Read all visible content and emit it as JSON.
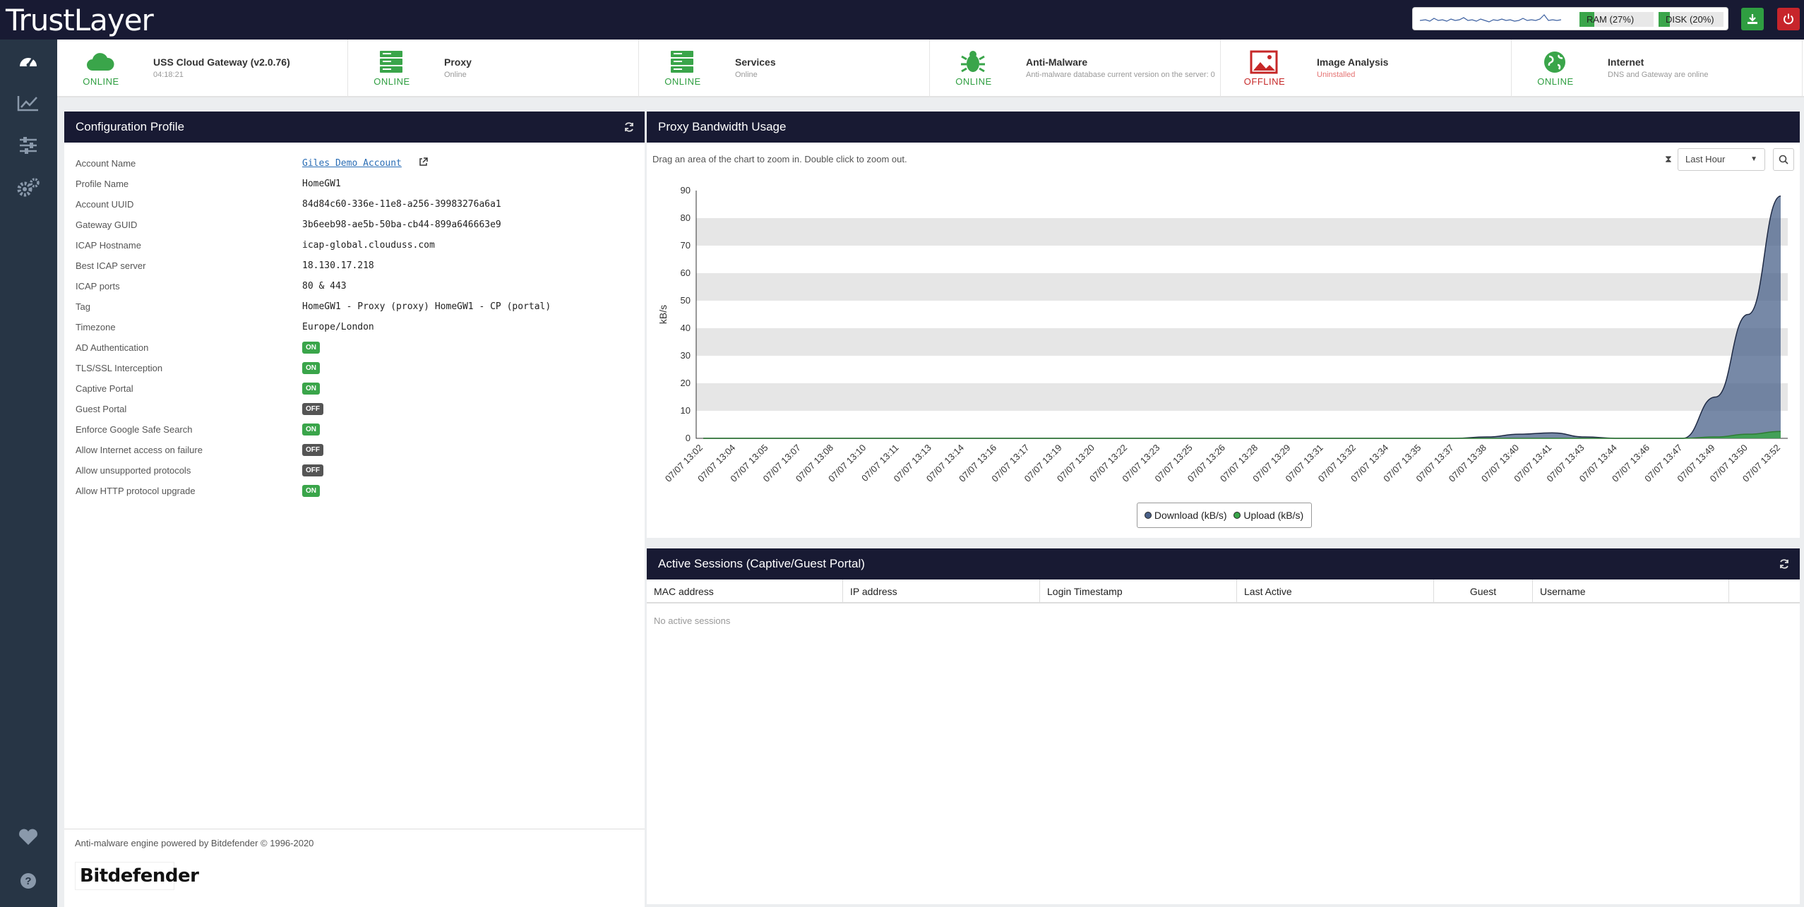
{
  "app": {
    "logo": "TrustLayer"
  },
  "resources": {
    "ram": "RAM (27%)",
    "ram_pct": 27,
    "disk": "DISK (20%)",
    "disk_pct": 20
  },
  "status_items": [
    {
      "name": "USS Cloud Gateway (v2.0.76)",
      "sub": "04:18:21",
      "state": "ONLINE",
      "icon": "cloud-icon"
    },
    {
      "name": "Proxy",
      "sub": "Online",
      "state": "ONLINE",
      "icon": "server-icon"
    },
    {
      "name": "Services",
      "sub": "Online",
      "state": "ONLINE",
      "icon": "server-icon"
    },
    {
      "name": "Anti-Malware",
      "sub": "Anti-malware database current version on the server: 0",
      "state": "ONLINE",
      "icon": "bug-icon"
    },
    {
      "name": "Image Analysis",
      "sub": "Uninstalled",
      "state": "OFFLINE",
      "icon": "image-icon"
    },
    {
      "name": "Internet",
      "sub": "DNS and Gateway are online",
      "state": "ONLINE",
      "icon": "globe-icon"
    }
  ],
  "config": {
    "title": "Configuration Profile",
    "rows": [
      {
        "key": "Account Name",
        "value": "Giles Demo Account"
      },
      {
        "key": "Profile Name",
        "value": "HomeGW1"
      },
      {
        "key": "Account UUID",
        "value": "84d84c60-336e-11e8-a256-39983276a6a1"
      },
      {
        "key": "Gateway GUID",
        "value": "3b6eeb98-ae5b-50ba-cb44-899a646663e9"
      },
      {
        "key": "ICAP Hostname",
        "value": "icap-global.clouduss.com"
      },
      {
        "key": "Best ICAP server",
        "value": "18.130.17.218"
      },
      {
        "key": "ICAP ports",
        "value": "80 & 443"
      },
      {
        "key": "Tag",
        "value": "HomeGW1 - Proxy (proxy) HomeGW1 - CP (portal)"
      },
      {
        "key": "Timezone",
        "value": "Europe/London"
      }
    ],
    "toggles": [
      {
        "key": "AD Authentication",
        "value": "ON"
      },
      {
        "key": "TLS/SSL Interception",
        "value": "ON"
      },
      {
        "key": "Captive Portal",
        "value": "ON"
      },
      {
        "key": "Guest Portal",
        "value": "OFF"
      },
      {
        "key": "Enforce Google Safe Search",
        "value": "ON"
      },
      {
        "key": "Allow Internet access on failure",
        "value": "OFF"
      },
      {
        "key": "Allow unsupported protocols",
        "value": "OFF"
      },
      {
        "key": "Allow HTTP protocol upgrade",
        "value": "ON"
      }
    ],
    "footer": "Anti-malware engine powered by Bitdefender © 1996-2020",
    "brand": "Bitdefender"
  },
  "bandwidth": {
    "title": "Proxy Bandwidth Usage",
    "hint": "Drag an area of the chart to zoom in. Double click to zoom out.",
    "range": "Last Hour",
    "legend_download": "Download (kB/s)",
    "legend_upload": "Upload (kB/s)"
  },
  "chart_data": {
    "type": "area",
    "ylabel": "kB/s",
    "ylim": [
      0,
      90
    ],
    "yticks": [
      0,
      10,
      20,
      30,
      40,
      50,
      60,
      70,
      80,
      90
    ],
    "x": [
      "07/07 13:02",
      "07/07 13:04",
      "07/07 13:05",
      "07/07 13:07",
      "07/07 13:08",
      "07/07 13:10",
      "07/07 13:11",
      "07/07 13:13",
      "07/07 13:14",
      "07/07 13:16",
      "07/07 13:17",
      "07/07 13:19",
      "07/07 13:20",
      "07/07 13:22",
      "07/07 13:23",
      "07/07 13:25",
      "07/07 13:26",
      "07/07 13:28",
      "07/07 13:29",
      "07/07 13:31",
      "07/07 13:32",
      "07/07 13:34",
      "07/07 13:35",
      "07/07 13:37",
      "07/07 13:38",
      "07/07 13:40",
      "07/07 13:41",
      "07/07 13:43",
      "07/07 13:44",
      "07/07 13:46",
      "07/07 13:47",
      "07/07 13:49",
      "07/07 13:50",
      "07/07 13:52"
    ],
    "series": [
      {
        "name": "Download (kB/s)",
        "color": "#4a6189",
        "values": [
          0,
          0,
          0,
          0,
          0,
          0,
          0,
          0,
          0,
          0,
          0,
          0,
          0,
          0,
          0,
          0,
          0,
          0,
          0,
          0,
          0,
          0,
          0,
          0,
          0.5,
          1.5,
          2,
          0.5,
          0,
          0,
          0,
          15,
          45,
          88
        ]
      },
      {
        "name": "Upload (kB/s)",
        "color": "#3aa54a",
        "values": [
          0,
          0,
          0,
          0,
          0,
          0,
          0,
          0,
          0,
          0,
          0,
          0,
          0,
          0,
          0,
          0,
          0,
          0,
          0,
          0,
          0,
          0,
          0,
          0,
          0,
          0,
          0,
          0,
          0,
          0,
          0,
          0.5,
          1.5,
          2.5
        ]
      }
    ],
    "grid": true,
    "legend": "bottom"
  },
  "sessions": {
    "title": "Active Sessions (Captive/Guest Portal)",
    "columns": [
      "MAC address",
      "IP address",
      "Login Timestamp",
      "Last Active",
      "Guest",
      "Username"
    ],
    "empty": "No active sessions"
  }
}
